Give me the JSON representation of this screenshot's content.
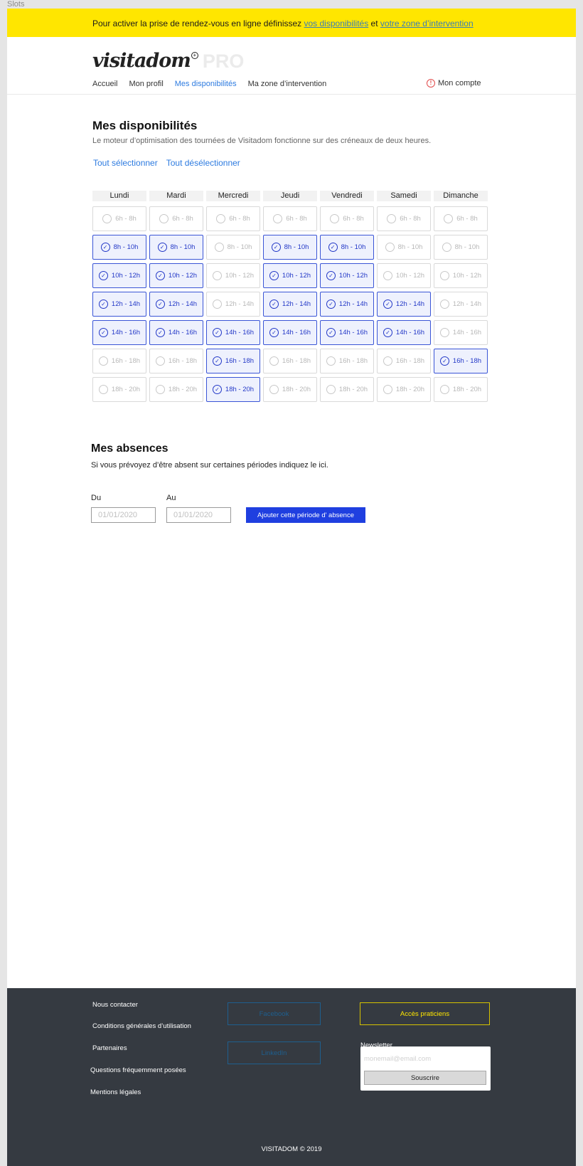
{
  "frame_label": "Slots",
  "banner": {
    "text_before": "Pour activer la prise de rendez-vous en ligne définissez ",
    "link1": "vos disponibilités",
    "text_mid": " et ",
    "link2": "votre zone d’intervention"
  },
  "brand": {
    "name": "visitadom",
    "suffix": "PRO"
  },
  "nav": {
    "items": [
      {
        "label": "Accueil",
        "active": false
      },
      {
        "label": "Mon profil",
        "active": false
      },
      {
        "label": "Mes disponibilités",
        "active": true
      },
      {
        "label": "Ma zone d’intervention",
        "active": false
      }
    ],
    "account": "Mon compte",
    "account_icon": "alert-circle-icon"
  },
  "availability": {
    "title": "Mes disponibilités",
    "subtitle": "Le moteur d’optimisation des tournées de Visitadom fonctionne sur des créneaux de deux heures.",
    "select_all": "Tout sélectionner",
    "deselect_all": "Tout désélectionner",
    "days": [
      {
        "label": "Lundi",
        "selected": [
          false,
          true,
          true,
          true,
          true,
          false,
          false
        ]
      },
      {
        "label": "Mardi",
        "selected": [
          false,
          true,
          true,
          true,
          true,
          false,
          false
        ]
      },
      {
        "label": "Mercredi",
        "selected": [
          false,
          false,
          false,
          false,
          true,
          true,
          true
        ]
      },
      {
        "label": "Jeudi",
        "selected": [
          false,
          true,
          true,
          true,
          true,
          false,
          false
        ]
      },
      {
        "label": "Vendredi",
        "selected": [
          false,
          true,
          true,
          true,
          true,
          false,
          false
        ]
      },
      {
        "label": "Samedi",
        "selected": [
          false,
          false,
          false,
          true,
          true,
          false,
          false
        ]
      },
      {
        "label": "Dimanche",
        "selected": [
          false,
          false,
          false,
          false,
          false,
          true,
          false
        ]
      }
    ],
    "slots": [
      "6h - 8h",
      "8h - 10h",
      "10h - 12h",
      "12h - 14h",
      "14h - 16h",
      "16h - 18h",
      "18h - 20h"
    ]
  },
  "absences": {
    "title": "Mes absences",
    "subtitle": "Si vous prévoyez d’être absent sur certaines périodes indiquez le ici.",
    "from_label": "Du",
    "to_label": "Au",
    "from_placeholder": "01/01/2020",
    "to_placeholder": "01/01/2020",
    "add_button": "Ajouter cette période d' absence"
  },
  "footer": {
    "links": [
      "Nous contacter",
      "Conditions générales d’utilisation",
      "Partenaires",
      "Questions fréquemment posées",
      "Mentions légales"
    ],
    "facebook": "Facebook",
    "linkedin": "LinkedIn",
    "practitioners": "Accès praticiens",
    "newsletter_label": "Newsletter",
    "newsletter_placeholder": "monemail@email.com",
    "subscribe": "Souscrire",
    "copyright": "VISITADOM © 2019"
  },
  "colors": {
    "banner": "#ffe600",
    "primary": "#1f3fe0",
    "link": "#2d7be0",
    "footer": "#353a41"
  }
}
